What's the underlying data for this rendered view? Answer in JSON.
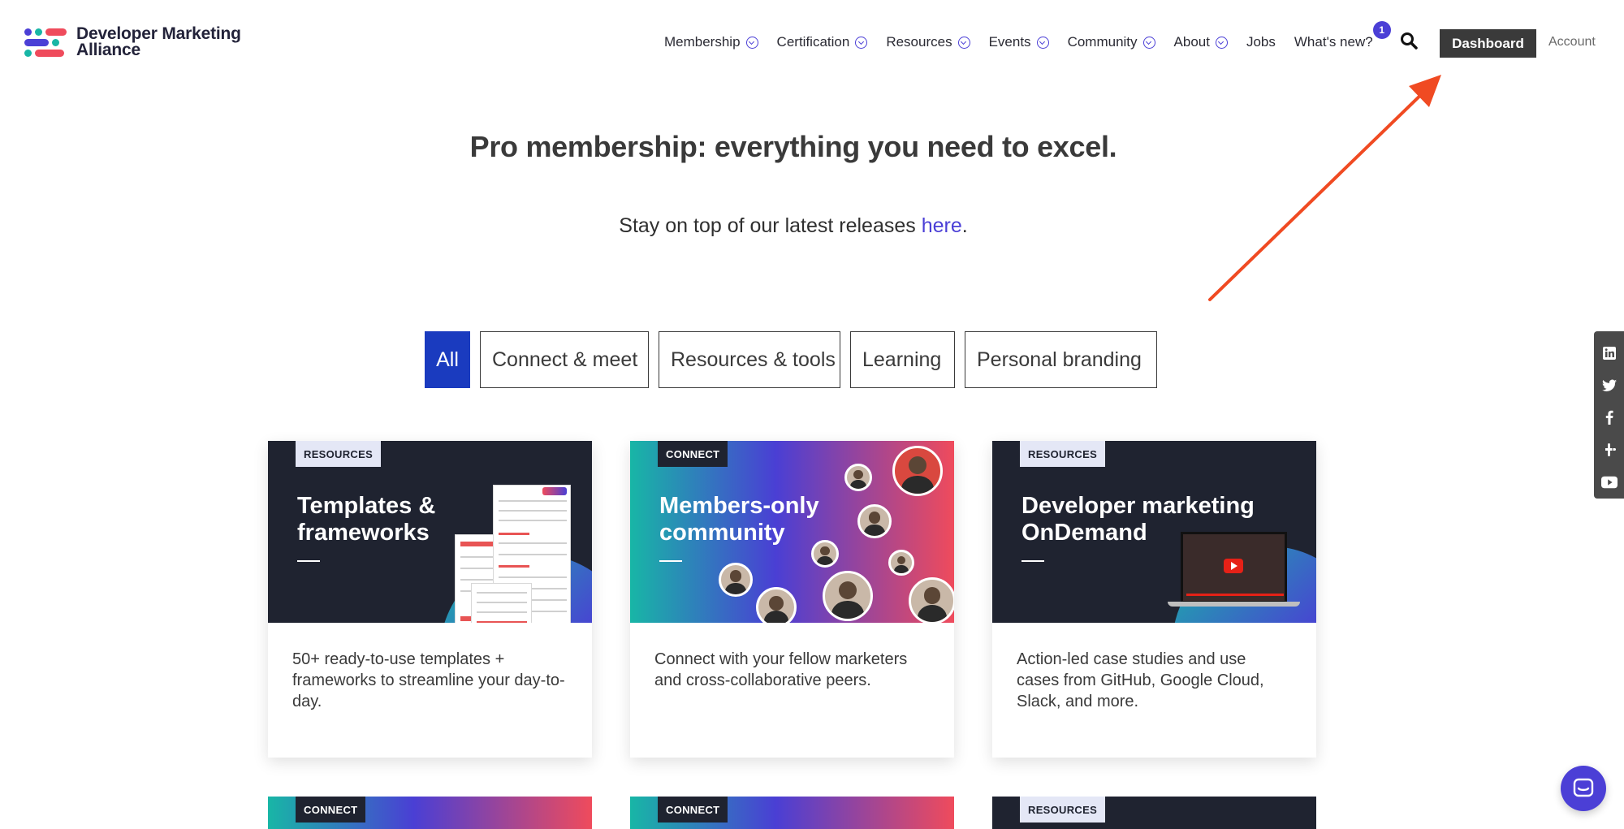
{
  "logo": {
    "line1": "Developer Marketing",
    "line2": "Alliance"
  },
  "nav": {
    "items": [
      {
        "label": "Membership",
        "has_dropdown": true
      },
      {
        "label": "Certification",
        "has_dropdown": true
      },
      {
        "label": "Resources",
        "has_dropdown": true
      },
      {
        "label": "Events",
        "has_dropdown": true
      },
      {
        "label": "Community",
        "has_dropdown": true
      },
      {
        "label": "About",
        "has_dropdown": true
      },
      {
        "label": "Jobs",
        "has_dropdown": false
      },
      {
        "label": "What's new?",
        "has_dropdown": false
      }
    ],
    "whats_new_badge": "1",
    "dashboard_label": "Dashboard",
    "account_label": "Account"
  },
  "hero": {
    "title": "Pro membership: everything you need to excel.",
    "sub_prefix": "Stay on top of our latest releases ",
    "sub_link": "here",
    "sub_suffix": "."
  },
  "filters": [
    {
      "label": "All",
      "active": true
    },
    {
      "label": "Connect & meet",
      "active": false
    },
    {
      "label": "Resources & tools",
      "active": false
    },
    {
      "label": "Learning",
      "active": false
    },
    {
      "label": "Personal branding",
      "active": false
    }
  ],
  "cards": [
    {
      "tag": "RESOURCES",
      "title": "Templates & frameworks",
      "body": "50+ ready-to-use templates + frameworks to streamline your day-to-day."
    },
    {
      "tag": "CONNECT",
      "title": "Members-only community",
      "body": "Connect with your fellow marketers and cross-collaborative peers."
    },
    {
      "tag": "RESOURCES",
      "title": "Developer marketing OnDemand",
      "body": "Action-led case studies and use cases from GitHub, Google Cloud, Slack, and more."
    }
  ],
  "cards_row2": [
    {
      "tag": "CONNECT"
    },
    {
      "tag": "CONNECT"
    },
    {
      "tag": "RESOURCES"
    }
  ],
  "social": [
    "linkedin-icon",
    "twitter-icon",
    "facebook-icon",
    "slack-icon",
    "youtube-icon"
  ],
  "colors": {
    "accent": "#4b3fd6",
    "filter_active": "#1a3bbf",
    "arrow": "#f04a22",
    "card_dark": "#1f2330"
  }
}
